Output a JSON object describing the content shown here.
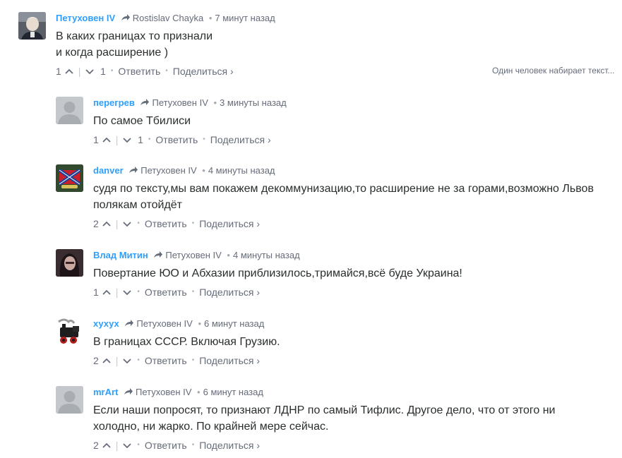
{
  "typing_indicator": "Один человек набирает текст...",
  "comments": [
    {
      "author": "Петуховен IV",
      "reply_to": "Rostislav Chayka",
      "time": "7 минут назад",
      "lines": [
        "В каких границах то признали",
        "и когда расширение )"
      ],
      "upvotes": "1",
      "downvotes": "1",
      "reply_label": "Ответить",
      "share_label": "Поделиться ›",
      "avatar": "photo-avatar"
    },
    {
      "author": "перегрев",
      "reply_to": "Петуховен IV",
      "time": "3 минуты назад",
      "lines": [
        "По самое Тбилиси"
      ],
      "upvotes": "1",
      "downvotes": "1",
      "reply_label": "Ответить",
      "share_label": "Поделиться ›",
      "avatar": "default-avatar"
    },
    {
      "author": "danver",
      "reply_to": "Петуховен IV",
      "time": "4 минуты назад",
      "lines": [
        "судя по тексту,мы вам покажем декоммунизацию,то расширение не за горами,возможно Львов",
        "полякам отойдёт"
      ],
      "upvotes": "2",
      "downvotes": "",
      "reply_label": "Ответить",
      "share_label": "Поделиться ›",
      "avatar": "flag-avatar"
    },
    {
      "author": "Влад Митин",
      "reply_to": "Петуховен IV",
      "time": "4 минуты назад",
      "lines": [
        "Повертание ЮО и Абхазии приблизилось,тримайся,всё буде Украина!"
      ],
      "upvotes": "1",
      "downvotes": "",
      "reply_label": "Ответить",
      "share_label": "Поделиться ›",
      "avatar": "photo-avatar"
    },
    {
      "author": "хухух",
      "reply_to": "Петуховен IV",
      "time": "6 минут назад",
      "lines": [
        "В границах СССР. Включая Грузию."
      ],
      "upvotes": "2",
      "downvotes": "",
      "reply_label": "Ответить",
      "share_label": "Поделиться ›",
      "avatar": "train-avatar"
    },
    {
      "author": "mrArt",
      "reply_to": "Петуховен IV",
      "time": "6 минут назад",
      "lines": [
        "Если наши попросят, то признают ЛДНР по самый Тифлис. Другое дело, что от этого ни",
        "холодно, ни жарко. По крайней мере сейчас."
      ],
      "upvotes": "2",
      "downvotes": "",
      "reply_label": "Ответить",
      "share_label": "Поделиться ›",
      "avatar": "default-avatar"
    }
  ]
}
